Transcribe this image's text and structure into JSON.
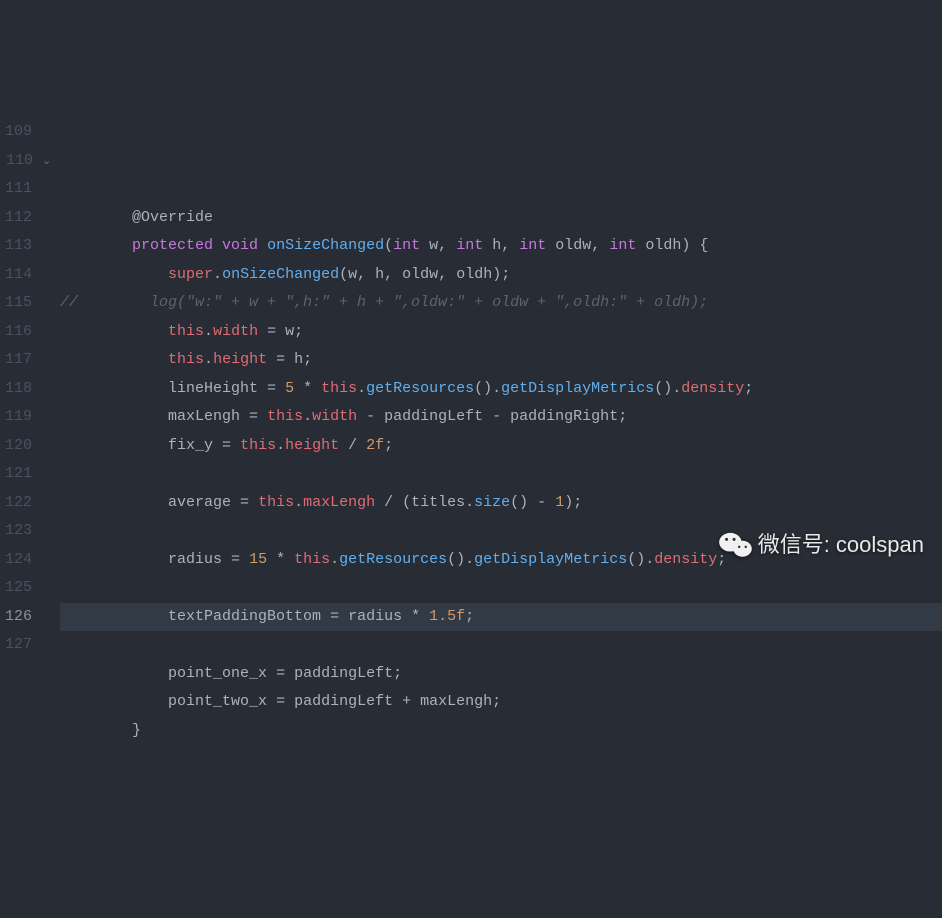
{
  "startLine": 109,
  "foldLine": 110,
  "activeLine": 126,
  "lines": [
    {
      "n": 109,
      "tokens": [
        [
          "pad",
          "        "
        ],
        [
          "ann",
          "@Override"
        ]
      ]
    },
    {
      "n": 110,
      "tokens": [
        [
          "pad",
          "        "
        ],
        [
          "k",
          "protected"
        ],
        [
          "op",
          " "
        ],
        [
          "k",
          "void"
        ],
        [
          "op",
          " "
        ],
        [
          "fn",
          "onSizeChanged"
        ],
        [
          "op",
          "("
        ],
        [
          "ty",
          "int"
        ],
        [
          "op",
          " "
        ],
        [
          "id",
          "w"
        ],
        [
          "op",
          ", "
        ],
        [
          "ty",
          "int"
        ],
        [
          "op",
          " "
        ],
        [
          "id",
          "h"
        ],
        [
          "op",
          ", "
        ],
        [
          "ty",
          "int"
        ],
        [
          "op",
          " "
        ],
        [
          "id",
          "oldw"
        ],
        [
          "op",
          ", "
        ],
        [
          "ty",
          "int"
        ],
        [
          "op",
          " "
        ],
        [
          "id",
          "oldh"
        ],
        [
          "op",
          ") {"
        ]
      ]
    },
    {
      "n": 111,
      "tokens": [
        [
          "pad",
          "            "
        ],
        [
          "self",
          "super"
        ],
        [
          "op",
          "."
        ],
        [
          "fn",
          "onSizeChanged"
        ],
        [
          "op",
          "("
        ],
        [
          "id",
          "w"
        ],
        [
          "op",
          ", "
        ],
        [
          "id",
          "h"
        ],
        [
          "op",
          ", "
        ],
        [
          "id",
          "oldw"
        ],
        [
          "op",
          ", "
        ],
        [
          "id",
          "oldh"
        ],
        [
          "op",
          ");"
        ]
      ]
    },
    {
      "n": 112,
      "tokens": [
        [
          "c",
          "//        log(\"w:\" + w + \",h:\" + h + \",oldw:\" + oldw + \",oldh:\" + oldh);"
        ]
      ]
    },
    {
      "n": 113,
      "tokens": [
        [
          "pad",
          "            "
        ],
        [
          "self",
          "this"
        ],
        [
          "op",
          "."
        ],
        [
          "pr",
          "width"
        ],
        [
          "op",
          " = "
        ],
        [
          "id",
          "w"
        ],
        [
          "op",
          ";"
        ]
      ]
    },
    {
      "n": 114,
      "tokens": [
        [
          "pad",
          "            "
        ],
        [
          "self",
          "this"
        ],
        [
          "op",
          "."
        ],
        [
          "pr",
          "height"
        ],
        [
          "op",
          " = "
        ],
        [
          "id",
          "h"
        ],
        [
          "op",
          ";"
        ]
      ]
    },
    {
      "n": 115,
      "tokens": [
        [
          "pad",
          "            "
        ],
        [
          "id",
          "lineHeight"
        ],
        [
          "op",
          " = "
        ],
        [
          "n",
          "5"
        ],
        [
          "op",
          " * "
        ],
        [
          "self",
          "this"
        ],
        [
          "op",
          "."
        ],
        [
          "fn",
          "getResources"
        ],
        [
          "op",
          "()."
        ],
        [
          "fn",
          "getDisplayMetrics"
        ],
        [
          "op",
          "()."
        ],
        [
          "pr",
          "density"
        ],
        [
          "op",
          ";"
        ]
      ]
    },
    {
      "n": 116,
      "tokens": [
        [
          "pad",
          "            "
        ],
        [
          "id",
          "maxLengh"
        ],
        [
          "op",
          " = "
        ],
        [
          "self",
          "this"
        ],
        [
          "op",
          "."
        ],
        [
          "pr",
          "width"
        ],
        [
          "op",
          " - "
        ],
        [
          "id",
          "paddingLeft"
        ],
        [
          "op",
          " - "
        ],
        [
          "id",
          "paddingRight"
        ],
        [
          "op",
          ";"
        ]
      ]
    },
    {
      "n": 117,
      "tokens": [
        [
          "pad",
          "            "
        ],
        [
          "id",
          "fix_y"
        ],
        [
          "op",
          " = "
        ],
        [
          "self",
          "this"
        ],
        [
          "op",
          "."
        ],
        [
          "pr",
          "height"
        ],
        [
          "op",
          " / "
        ],
        [
          "n",
          "2f"
        ],
        [
          "op",
          ";"
        ]
      ]
    },
    {
      "n": 118,
      "tokens": []
    },
    {
      "n": 119,
      "tokens": [
        [
          "pad",
          "            "
        ],
        [
          "id",
          "average"
        ],
        [
          "op",
          " = "
        ],
        [
          "self",
          "this"
        ],
        [
          "op",
          "."
        ],
        [
          "pr",
          "maxLengh"
        ],
        [
          "op",
          " / ("
        ],
        [
          "id",
          "titles"
        ],
        [
          "op",
          "."
        ],
        [
          "fn",
          "size"
        ],
        [
          "op",
          "() - "
        ],
        [
          "n",
          "1"
        ],
        [
          "op",
          ");"
        ]
      ]
    },
    {
      "n": 120,
      "tokens": []
    },
    {
      "n": 121,
      "tokens": [
        [
          "pad",
          "            "
        ],
        [
          "id",
          "radius"
        ],
        [
          "op",
          " = "
        ],
        [
          "n",
          "15"
        ],
        [
          "op",
          " * "
        ],
        [
          "self",
          "this"
        ],
        [
          "op",
          "."
        ],
        [
          "fn",
          "getResources"
        ],
        [
          "op",
          "()."
        ],
        [
          "fn",
          "getDisplayMetrics"
        ],
        [
          "op",
          "()."
        ],
        [
          "pr",
          "density"
        ],
        [
          "op",
          ";"
        ]
      ]
    },
    {
      "n": 122,
      "tokens": []
    },
    {
      "n": 123,
      "tokens": [
        [
          "pad",
          "            "
        ],
        [
          "id",
          "textPaddingBottom"
        ],
        [
          "op",
          " = "
        ],
        [
          "id",
          "radius"
        ],
        [
          "op",
          " * "
        ],
        [
          "n",
          "1.5f"
        ],
        [
          "op",
          ";"
        ]
      ]
    },
    {
      "n": 124,
      "tokens": []
    },
    {
      "n": 125,
      "tokens": [
        [
          "pad",
          "            "
        ],
        [
          "id",
          "point_one_x"
        ],
        [
          "op",
          " = "
        ],
        [
          "id",
          "paddingLeft"
        ],
        [
          "op",
          ";"
        ]
      ]
    },
    {
      "n": 126,
      "tokens": [
        [
          "pad",
          "            "
        ],
        [
          "id",
          "point_two_x"
        ],
        [
          "op",
          " = "
        ],
        [
          "id",
          "paddingLeft"
        ],
        [
          "op",
          " + "
        ],
        [
          "id",
          "maxLengh"
        ],
        [
          "op",
          ";"
        ]
      ]
    },
    {
      "n": 127,
      "tokens": [
        [
          "pad",
          "        "
        ],
        [
          "op",
          "}"
        ]
      ]
    }
  ],
  "watermark": {
    "label": "微信号: coolspan"
  }
}
